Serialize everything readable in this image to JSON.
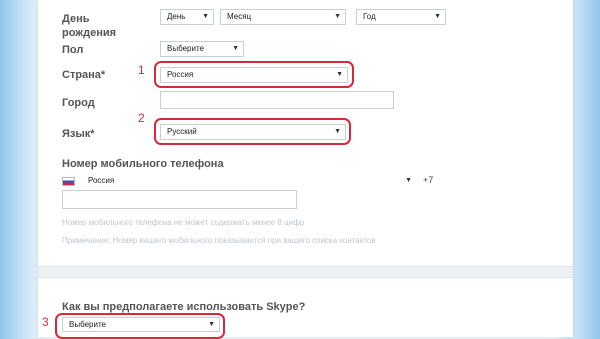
{
  "form": {
    "birthday": {
      "label": "День рождения",
      "day": "День",
      "month": "Месяц",
      "year": "Год"
    },
    "gender": {
      "label": "Пол",
      "value": "Выберите"
    },
    "country": {
      "label": "Страна*",
      "value": "Россия"
    },
    "city": {
      "label": "Город",
      "value": ""
    },
    "language": {
      "label": "Язык*",
      "value": "Русский"
    },
    "mobile": {
      "label": "Номер мобильного телефона",
      "country_value": "Россия",
      "code": "+7",
      "value": "",
      "hint1": "Номер мобильного телефона не может содержать менее 8 цифр",
      "hint2": "Примечание: Номер вашего мобильного показывается при вашего списка контактов"
    },
    "usage": {
      "label": "Как вы предполагаете использовать Skype?",
      "value": "Выберите"
    }
  },
  "annotations": {
    "one": "1",
    "two": "2",
    "three": "3",
    "color": "#d42a3a"
  }
}
